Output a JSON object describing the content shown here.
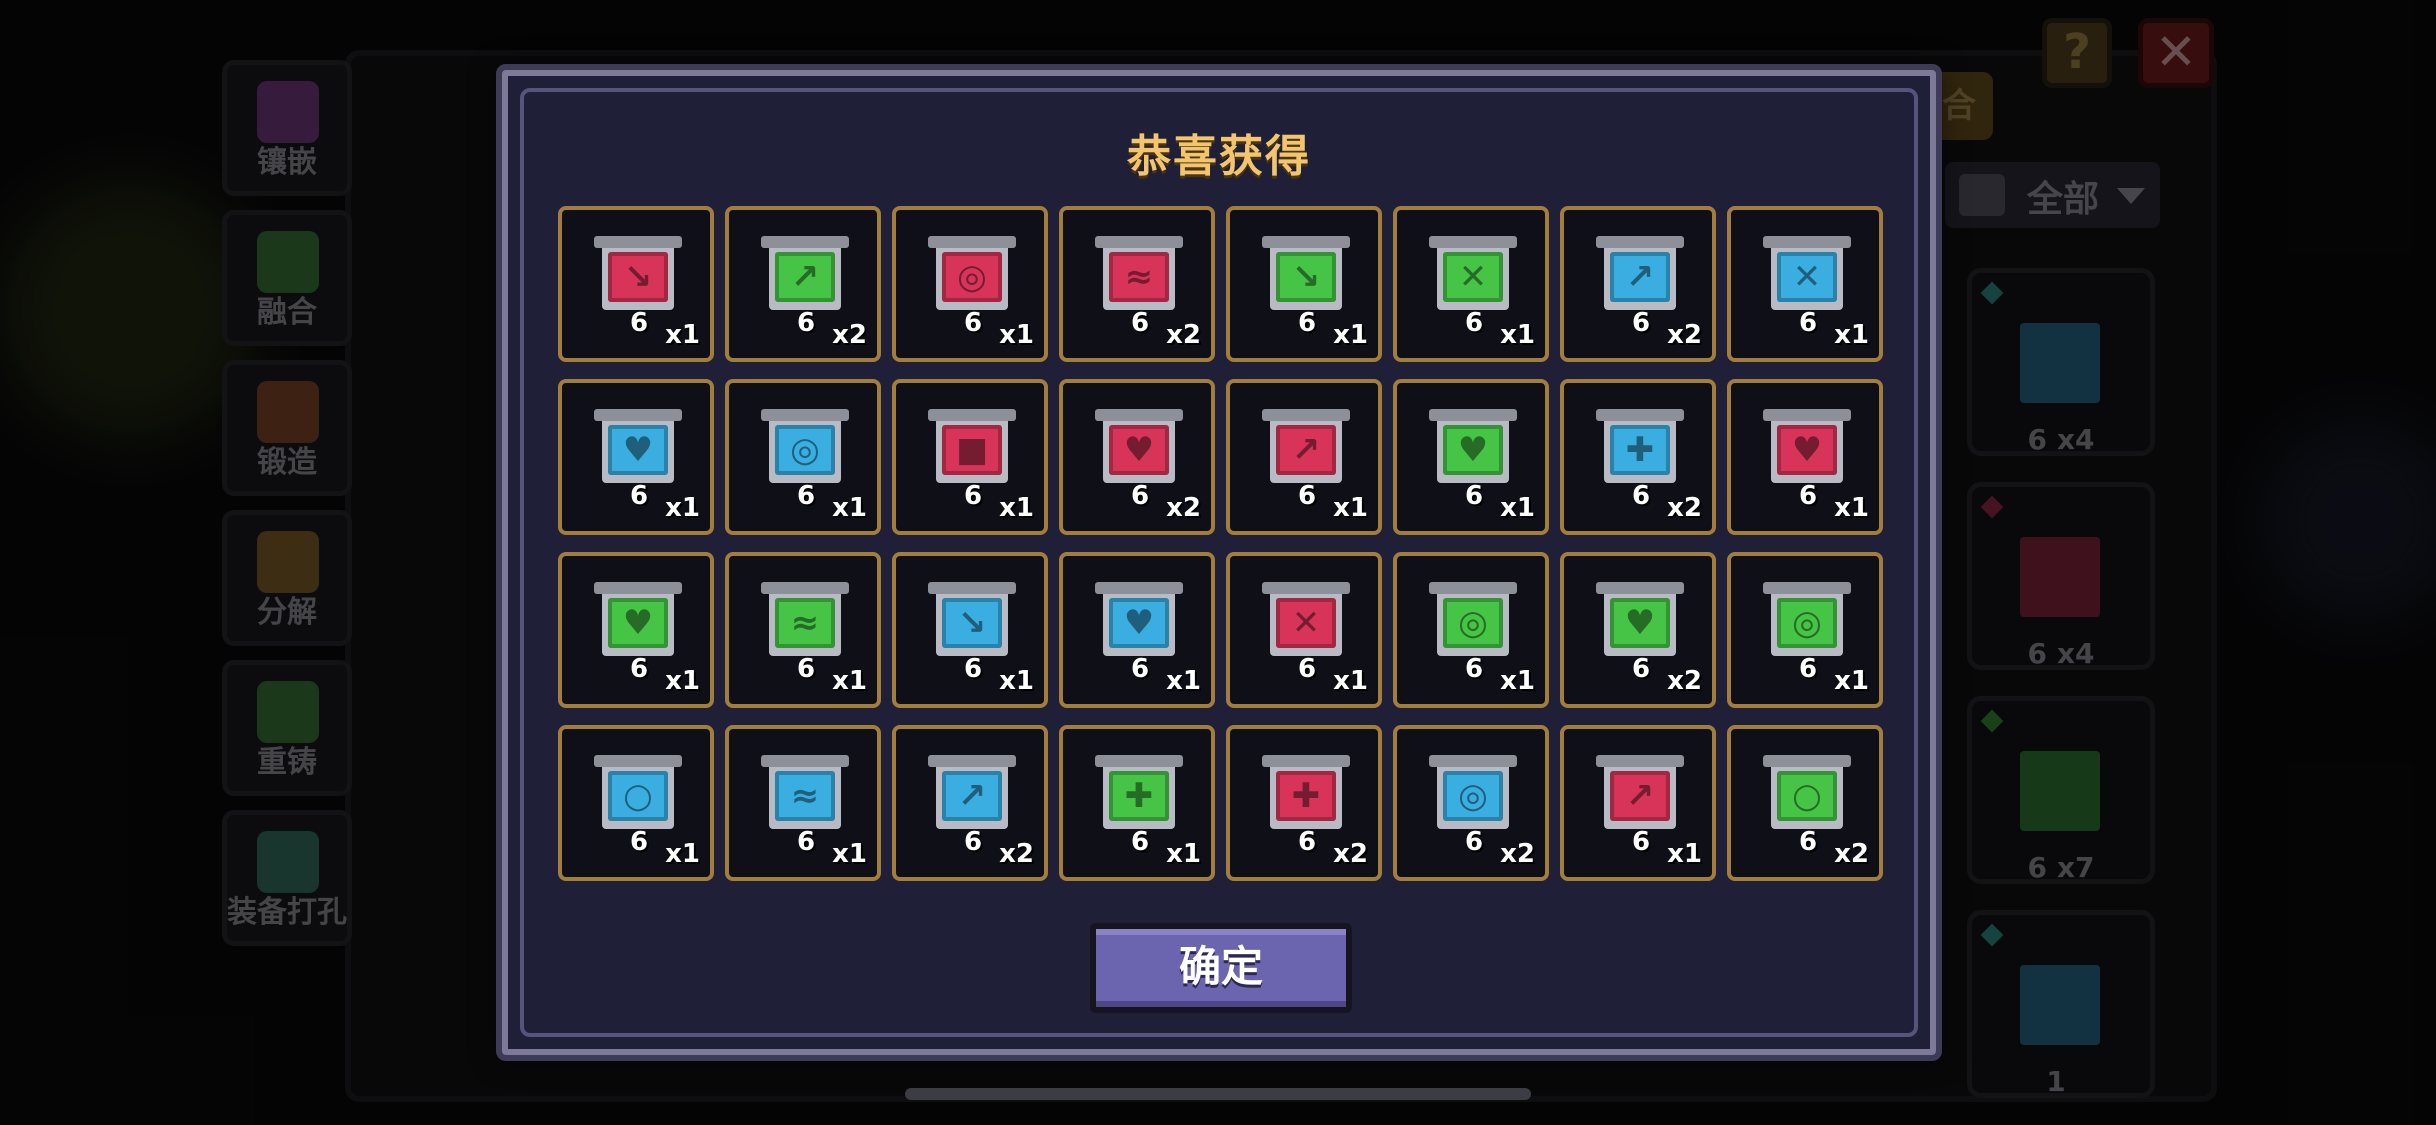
{
  "side_menu": [
    {
      "label": "镶嵌",
      "icon": "potion-icon",
      "color": "#c85ad8"
    },
    {
      "label": "融合",
      "icon": "fusion-rings-icon",
      "color": "#58d050"
    },
    {
      "label": "锻造",
      "icon": "forge-icon",
      "color": "#e0763a"
    },
    {
      "label": "分解",
      "icon": "disassemble-icon",
      "color": "#e0a030"
    },
    {
      "label": "重铸",
      "icon": "recast-icon",
      "color": "#58d050"
    },
    {
      "label": "装备打孔",
      "icon": "punch-hole-icon",
      "color": "#4ac0a0"
    }
  ],
  "header_buttons": {
    "help": "?",
    "close": "✕"
  },
  "tab_partial": "合",
  "filter": {
    "label": "全部"
  },
  "inventory": [
    {
      "level": "6",
      "qty": "x4",
      "color": "#3aaee0",
      "diamond": "#3ad0c0"
    },
    {
      "level": "6",
      "qty": "x4",
      "color": "#d8345a",
      "diamond": "#d8345a"
    },
    {
      "level": "6",
      "qty": "x7",
      "color": "#46c446",
      "diamond": "#46c446"
    },
    {
      "level": "1",
      "qty": "",
      "color": "#3aaee0",
      "diamond": "#3ad0c0"
    }
  ],
  "modal": {
    "title": "恭喜获得",
    "confirm_label": "确定",
    "rewards": [
      {
        "level": "6",
        "qty": "x1",
        "color": "#d8345a",
        "mark": "↘"
      },
      {
        "level": "6",
        "qty": "x2",
        "color": "#46c446",
        "mark": "↗"
      },
      {
        "level": "6",
        "qty": "x1",
        "color": "#d8345a",
        "mark": "◎"
      },
      {
        "level": "6",
        "qty": "x2",
        "color": "#d8345a",
        "mark": "≈"
      },
      {
        "level": "6",
        "qty": "x1",
        "color": "#46c446",
        "mark": "↘"
      },
      {
        "level": "6",
        "qty": "x1",
        "color": "#46c446",
        "mark": "✕"
      },
      {
        "level": "6",
        "qty": "x2",
        "color": "#3aaee0",
        "mark": "↗"
      },
      {
        "level": "6",
        "qty": "x1",
        "color": "#3aaee0",
        "mark": "✕"
      },
      {
        "level": "6",
        "qty": "x1",
        "color": "#3aaee0",
        "mark": "♥"
      },
      {
        "level": "6",
        "qty": "x1",
        "color": "#3aaee0",
        "mark": "◎"
      },
      {
        "level": "6",
        "qty": "x1",
        "color": "#d8345a",
        "mark": "■"
      },
      {
        "level": "6",
        "qty": "x2",
        "color": "#d8345a",
        "mark": "♥"
      },
      {
        "level": "6",
        "qty": "x1",
        "color": "#d8345a",
        "mark": "↗"
      },
      {
        "level": "6",
        "qty": "x1",
        "color": "#46c446",
        "mark": "♥"
      },
      {
        "level": "6",
        "qty": "x2",
        "color": "#3aaee0",
        "mark": "✚"
      },
      {
        "level": "6",
        "qty": "x1",
        "color": "#d8345a",
        "mark": "♥"
      },
      {
        "level": "6",
        "qty": "x1",
        "color": "#46c446",
        "mark": "♥"
      },
      {
        "level": "6",
        "qty": "x1",
        "color": "#46c446",
        "mark": "≈"
      },
      {
        "level": "6",
        "qty": "x1",
        "color": "#3aaee0",
        "mark": "↘"
      },
      {
        "level": "6",
        "qty": "x1",
        "color": "#3aaee0",
        "mark": "♥"
      },
      {
        "level": "6",
        "qty": "x1",
        "color": "#d8345a",
        "mark": "✕"
      },
      {
        "level": "6",
        "qty": "x1",
        "color": "#46c446",
        "mark": "◎"
      },
      {
        "level": "6",
        "qty": "x2",
        "color": "#46c446",
        "mark": "♥"
      },
      {
        "level": "6",
        "qty": "x1",
        "color": "#46c446",
        "mark": "◎"
      },
      {
        "level": "6",
        "qty": "x1",
        "color": "#3aaee0",
        "mark": "○"
      },
      {
        "level": "6",
        "qty": "x1",
        "color": "#3aaee0",
        "mark": "≈"
      },
      {
        "level": "6",
        "qty": "x2",
        "color": "#3aaee0",
        "mark": "↗"
      },
      {
        "level": "6",
        "qty": "x1",
        "color": "#46c446",
        "mark": "✚"
      },
      {
        "level": "6",
        "qty": "x2",
        "color": "#d8345a",
        "mark": "✚"
      },
      {
        "level": "6",
        "qty": "x2",
        "color": "#3aaee0",
        "mark": "◎"
      },
      {
        "level": "6",
        "qty": "x1",
        "color": "#d8345a",
        "mark": "↗"
      },
      {
        "level": "6",
        "qty": "x2",
        "color": "#46c446",
        "mark": "○"
      }
    ]
  }
}
